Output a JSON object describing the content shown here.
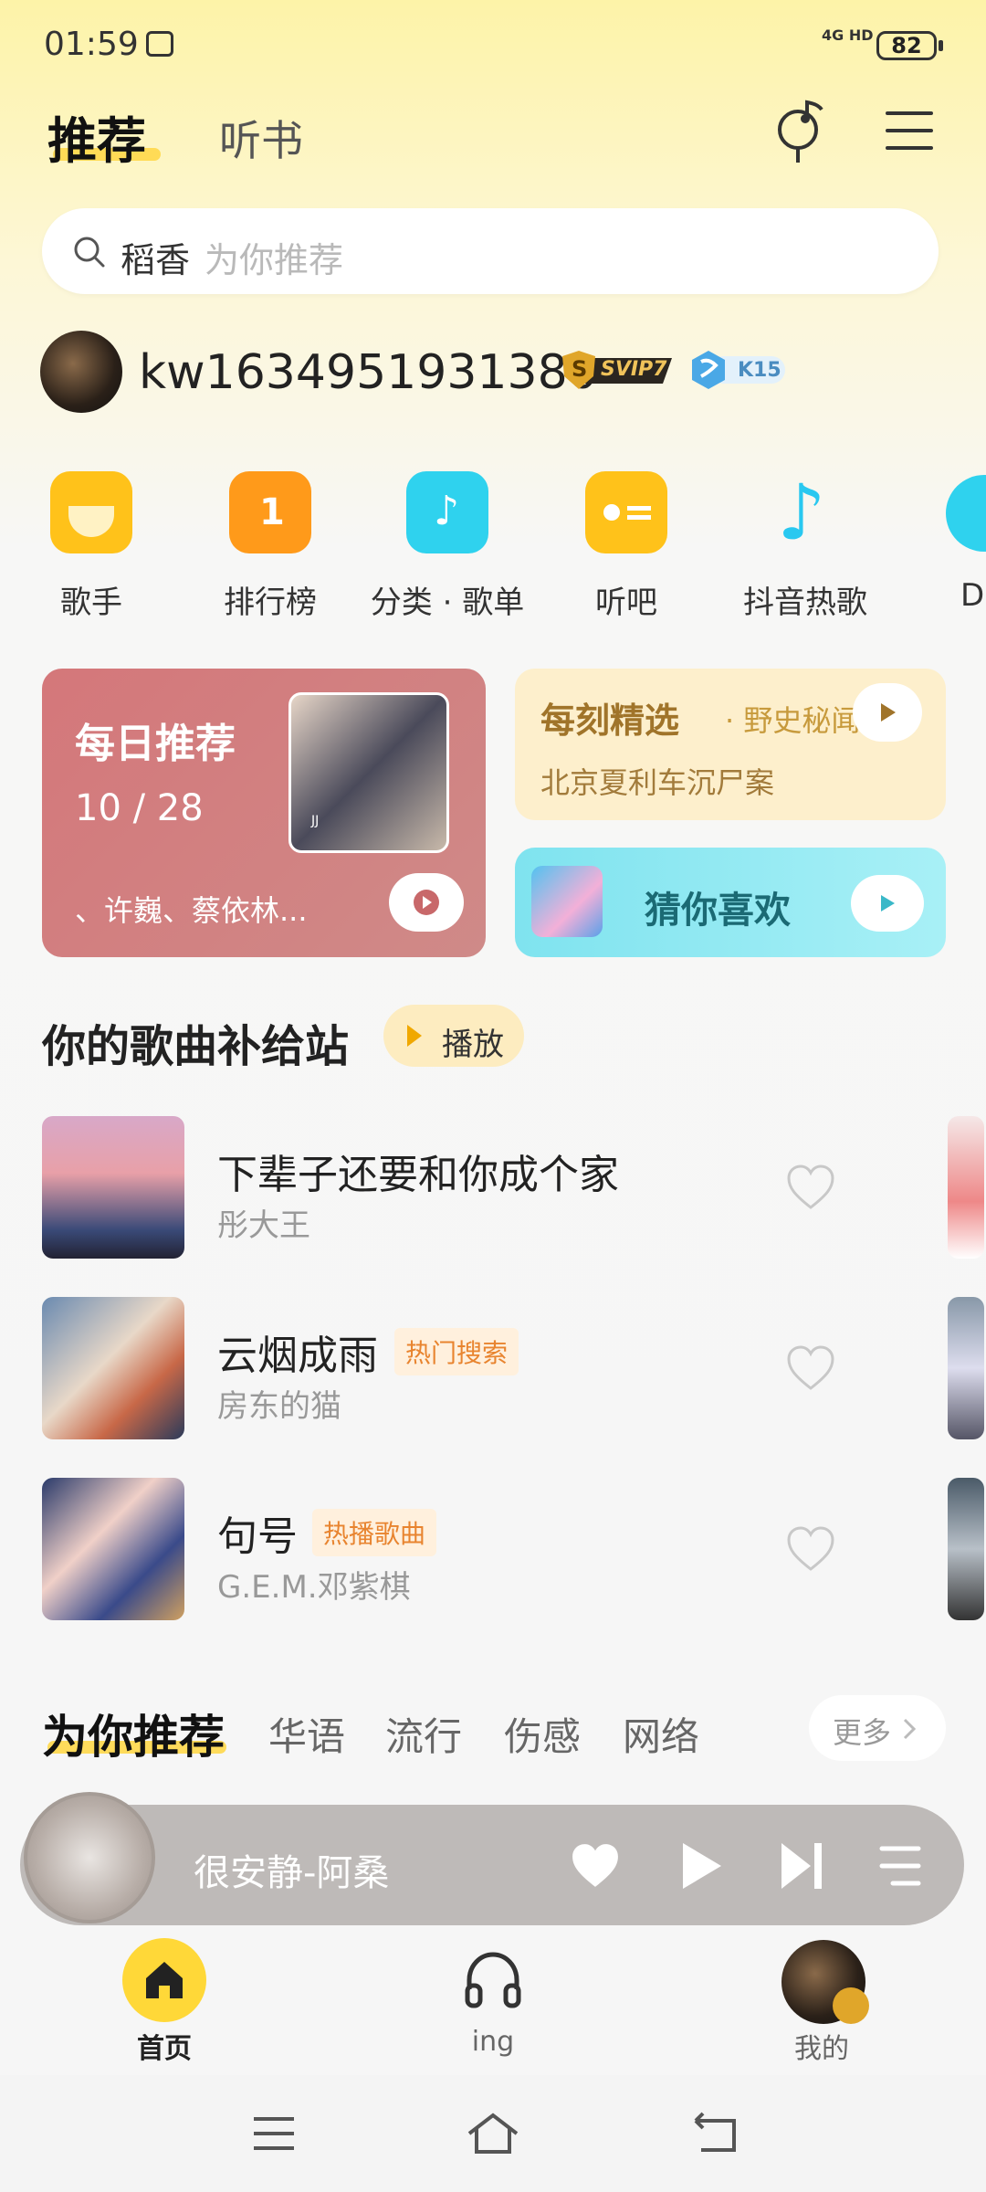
{
  "status": {
    "time": "01:59",
    "network": "4G HD",
    "battery": "82"
  },
  "top_tabs": {
    "recommend": "推荐",
    "audiobook": "听书"
  },
  "search": {
    "keyword": "稻香",
    "hint": "为你推荐"
  },
  "user": {
    "name": "kw1634951931380",
    "vip": "SVIP7",
    "vip_letter": "S",
    "level": "K15"
  },
  "quick": [
    {
      "label": "歌手",
      "icon": "singer-icon",
      "color": "#ffc21a"
    },
    {
      "label": "排行榜",
      "icon": "chart-rank-icon",
      "color": "#ff9a1a"
    },
    {
      "label": "分类 · 歌单",
      "icon": "playlist-note-icon",
      "color": "#2fd2ee"
    },
    {
      "label": "听吧",
      "icon": "radio-icon",
      "color": "#ffc21a"
    },
    {
      "label": "抖音热歌",
      "icon": "douyin-note-icon",
      "color": "#29c8f0"
    },
    {
      "label": "D",
      "icon": "dj-icon",
      "color": "#2fd2ee"
    }
  ],
  "daily": {
    "title": "每日推荐",
    "date": "10 / 28",
    "artists": "、许巍、蔡依林...",
    "art_label": "JJ"
  },
  "moment": {
    "title": "每刻精选",
    "subtitle": "· 野史秘闻",
    "desc": "北京夏利车沉尸案"
  },
  "guess": {
    "title": "猜你喜欢"
  },
  "section": {
    "title": "你的歌曲补给站",
    "play": "播放"
  },
  "songs": [
    {
      "title": "下辈子还要和你成个家",
      "artist": "彤大王",
      "tag": ""
    },
    {
      "title": "云烟成雨",
      "artist": "房东的猫",
      "tag": "热门搜索"
    },
    {
      "title": "句号",
      "artist": "G.E.M.邓紫棋",
      "tag": "热播歌曲"
    }
  ],
  "recommend_tabs": {
    "active": "为你推荐",
    "tabs": [
      "华语",
      "流行",
      "伤感",
      "网络"
    ],
    "more": "更多"
  },
  "player": {
    "title": "很安静-阿桑"
  },
  "bottom_nav": {
    "home": "首页",
    "ing": "ing",
    "me": "我的"
  },
  "colors": {
    "accent": "#ffd838",
    "tag_orange": "#e8842f"
  }
}
